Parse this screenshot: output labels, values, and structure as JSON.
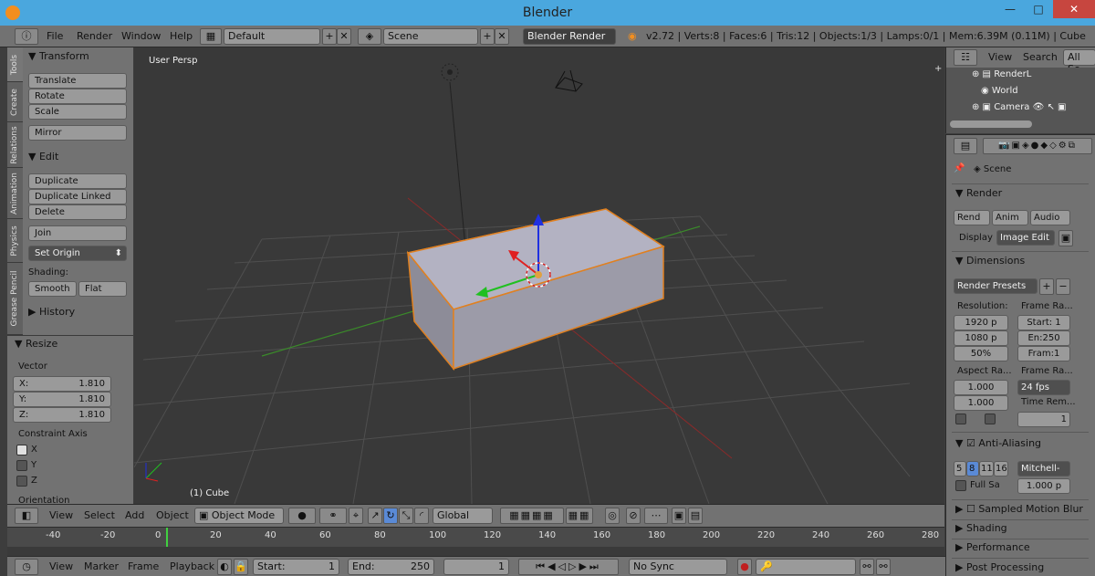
{
  "window": {
    "title": "Blender",
    "min": "—",
    "max": "□",
    "close": "✕"
  },
  "infobar": {
    "menus": [
      "File",
      "Render",
      "Window",
      "Help"
    ],
    "screen_layout": "Default",
    "scene": "Scene",
    "engine": "Blender Render",
    "stats": "v2.72 | Verts:8 | Faces:6 | Tris:12 | Objects:1/3 | Lamps:0/1 | Mem:6.39M (0.11M) | Cube"
  },
  "tool_tabs": [
    "Tools",
    "Create",
    "Relations",
    "Animation",
    "Physics",
    "Grease Pencil"
  ],
  "tools": {
    "transform_header": "Transform",
    "translate": "Translate",
    "rotate": "Rotate",
    "scale": "Scale",
    "mirror": "Mirror",
    "edit_header": "Edit",
    "duplicate": "Duplicate",
    "duplicate_linked": "Duplicate Linked",
    "delete": "Delete",
    "join": "Join",
    "set_origin": "Set Origin",
    "shading_label": "Shading:",
    "smooth": "Smooth",
    "flat": "Flat",
    "history_header": "History"
  },
  "operator": {
    "header": "Resize",
    "vector_label": "Vector",
    "x_label": "X:",
    "x_value": "1.810",
    "y_label": "Y:",
    "y_value": "1.810",
    "z_label": "Z:",
    "z_value": "1.810",
    "constraint_label": "Constraint Axis",
    "cx": "X",
    "cy": "Y",
    "cz": "Z",
    "orientation_label": "Orientation"
  },
  "viewport": {
    "view_name": "User Persp",
    "object_label": "(1) Cube"
  },
  "vp_header": {
    "menus": [
      "View",
      "Select",
      "Add",
      "Object"
    ],
    "mode": "Object Mode",
    "orientation": "Global"
  },
  "timeline": {
    "ticks": [
      "-40",
      "-20",
      "0",
      "20",
      "40",
      "60",
      "80",
      "100",
      "120",
      "140",
      "160",
      "180",
      "200",
      "220",
      "240",
      "260",
      "280"
    ],
    "current_frame": "1"
  },
  "tl_footer": {
    "menus": [
      "View",
      "Marker",
      "Frame",
      "Playback"
    ],
    "start_label": "Start:",
    "start_value": "1",
    "end_label": "End:",
    "end_value": "250",
    "current": "1",
    "sync": "No Sync"
  },
  "outliner": {
    "header_view": "View",
    "header_search": "Search",
    "header_scope": "All Sc",
    "items": [
      "RenderL",
      "World",
      "Camera"
    ]
  },
  "props": {
    "scene_label": "Scene",
    "render_header": "Render",
    "rend": "Rend",
    "anim": "Anim",
    "audio": "Audio",
    "display_label": "Display",
    "display_value": "Image Edit",
    "dimensions_header": "Dimensions",
    "render_presets": "Render Presets",
    "resolution_label": "Resolution:",
    "res_x": "1920 p",
    "res_y": "1080 p",
    "res_pct": "50%",
    "frame_range_label": "Frame Ra...",
    "start": "Start: 1",
    "end": "En:250",
    "step": "Fram:1",
    "aspect_label": "Aspect Ra...",
    "aspect_x": "1.000",
    "aspect_y": "1.000",
    "frame_rate_label": "Frame Ra...",
    "fps": "24 fps",
    "time_remap_label": "Time Rem...",
    "time_remap_value": "1",
    "aa_header": "Anti-Aliasing",
    "aa_samples": [
      "5",
      "8",
      "11",
      "16"
    ],
    "aa_filter": "Mitchell-",
    "full_sample": "Full Sa",
    "filter_size": "1.000 p",
    "sampled_motion": "Sampled Motion Blur",
    "shading_header": "Shading",
    "performance_header": "Performance",
    "post_header": "Post Processing"
  }
}
